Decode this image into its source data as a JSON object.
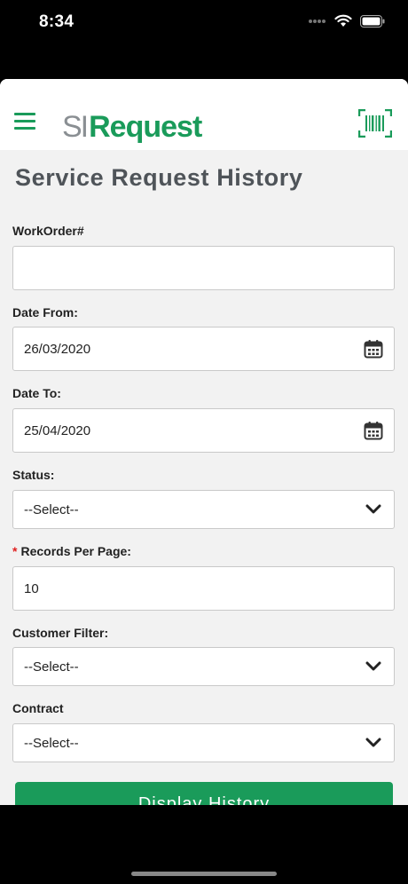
{
  "status_bar": {
    "time": "8:34"
  },
  "header": {
    "logo_si": "SI",
    "logo_request": "Request"
  },
  "page": {
    "title": "Service Request History"
  },
  "form": {
    "workorder": {
      "label": "WorkOrder#",
      "value": ""
    },
    "date_from": {
      "label": "Date From:",
      "value": "26/03/2020"
    },
    "date_to": {
      "label": "Date To:",
      "value": "25/04/2020"
    },
    "status": {
      "label": "Status:",
      "selected": "--Select--"
    },
    "records_per_page": {
      "required_mark": "*",
      "label": "Records Per Page:",
      "value": "10"
    },
    "customer_filter": {
      "label": "Customer Filter:",
      "selected": "--Select--"
    },
    "contract": {
      "label": "Contract",
      "selected": "--Select--"
    }
  },
  "actions": {
    "display_history": "Display History"
  },
  "colors": {
    "brand_green": "#1a9b5a",
    "title_gray": "#4f5459",
    "required_red": "#e02020"
  },
  "icons": [
    "hamburger-menu-icon",
    "barcode-scan-icon",
    "calendar-icon",
    "chevron-down-icon",
    "wifi-icon",
    "battery-icon",
    "signal-icon"
  ]
}
